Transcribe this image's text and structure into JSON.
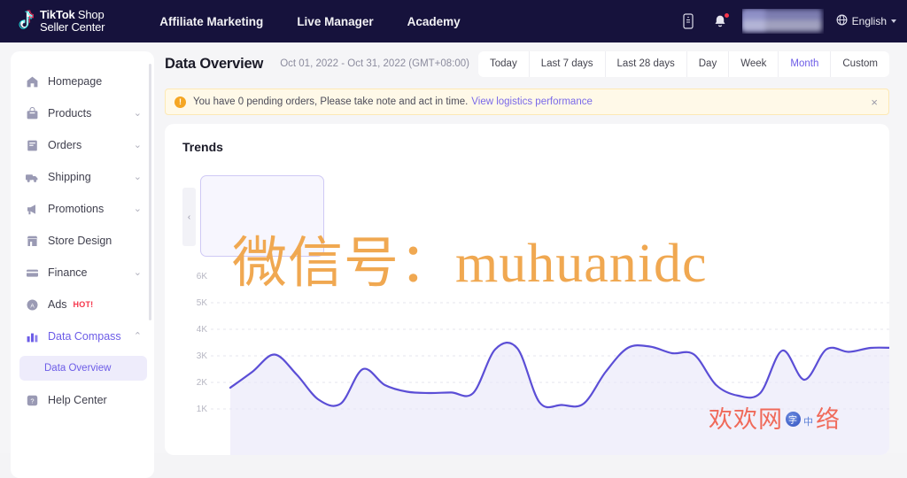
{
  "header": {
    "logo": {
      "brand": "TikTok",
      "sub1": " Shop",
      "sub2": "Seller Center",
      "icon": "tiktok-note-icon"
    },
    "nav": [
      {
        "label": "Affiliate Marketing"
      },
      {
        "label": "Live Manager"
      },
      {
        "label": "Academy"
      }
    ],
    "icons": [
      {
        "name": "mobile-app-icon",
        "glyph": "⎕"
      },
      {
        "name": "notification-bell-icon",
        "glyph": "🔔",
        "has_badge": true
      }
    ],
    "language": {
      "label": "English",
      "icon": "globe-icon"
    }
  },
  "sidebar": {
    "items": [
      {
        "label": "Homepage",
        "icon": "home-icon",
        "expandable": false,
        "active": false
      },
      {
        "label": "Products",
        "icon": "bag-icon",
        "expandable": true,
        "active": false
      },
      {
        "label": "Orders",
        "icon": "orders-icon",
        "expandable": true,
        "active": false
      },
      {
        "label": "Shipping",
        "icon": "truck-icon",
        "expandable": true,
        "active": false
      },
      {
        "label": "Promotions",
        "icon": "megaphone-icon",
        "expandable": true,
        "active": false
      },
      {
        "label": "Store Design",
        "icon": "store-icon",
        "expandable": false,
        "active": false
      },
      {
        "label": "Finance",
        "icon": "card-icon",
        "expandable": true,
        "active": false
      },
      {
        "label": "Ads",
        "icon": "ads-icon",
        "expandable": false,
        "active": false,
        "badge": "HOT!"
      },
      {
        "label": "Data Compass",
        "icon": "bar-chart-icon",
        "expandable": true,
        "active": true,
        "expanded": true
      },
      {
        "label": "Help Center",
        "icon": "help-icon",
        "expandable": false,
        "active": false
      }
    ],
    "subitem": {
      "label": "Data Overview",
      "selected": true
    },
    "chevron_down": "⌄",
    "chevron_up": "⌃"
  },
  "main": {
    "title": "Data Overview",
    "date_range": "Oct 01, 2022 - Oct 31, 2022 (GMT+08:00)",
    "range_filters": [
      {
        "label": "Today",
        "active": false
      },
      {
        "label": "Last 7 days",
        "active": false
      },
      {
        "label": "Last 28 days",
        "active": false
      },
      {
        "label": "Day",
        "active": false
      },
      {
        "label": "Week",
        "active": false
      },
      {
        "label": "Month",
        "active": true
      },
      {
        "label": "Custom",
        "active": false
      }
    ],
    "alert": {
      "icon": "warning-icon",
      "icon_glyph": "!",
      "text": "You have 0 pending orders, Please take note and act in time.",
      "link": "View logistics performance",
      "close": "×"
    },
    "trends": {
      "title": "Trends",
      "carousel_prev": "‹"
    }
  },
  "chart_data": {
    "type": "line",
    "title": "Trends",
    "xlabel": "",
    "ylabel": "",
    "ylim": [
      0,
      6500
    ],
    "grid": true,
    "line_color": "#5b4ed6",
    "area_color": "#e8e6f8",
    "ytick_labels": [
      "1K",
      "2K",
      "3K",
      "4K",
      "5K",
      "6K"
    ],
    "ytick_values": [
      1000,
      2000,
      3000,
      4000,
      5000,
      6000
    ],
    "series": [
      {
        "name": "Trend",
        "values": [
          1800,
          2400,
          3050,
          2300,
          1350,
          1200,
          2500,
          1900,
          1650,
          1600,
          1620,
          1600,
          3250,
          3280,
          1250,
          1150,
          1200,
          2400,
          3300,
          3350,
          3100,
          3050,
          1900,
          1500,
          1600,
          3200,
          2100,
          3250,
          3150,
          3300,
          3300
        ]
      }
    ]
  },
  "watermarks": {
    "main": "微信号：muhuanidc",
    "corner_before": "欢欢网",
    "corner_badge": "字",
    "corner_after": "络",
    "corner_small": "中"
  }
}
